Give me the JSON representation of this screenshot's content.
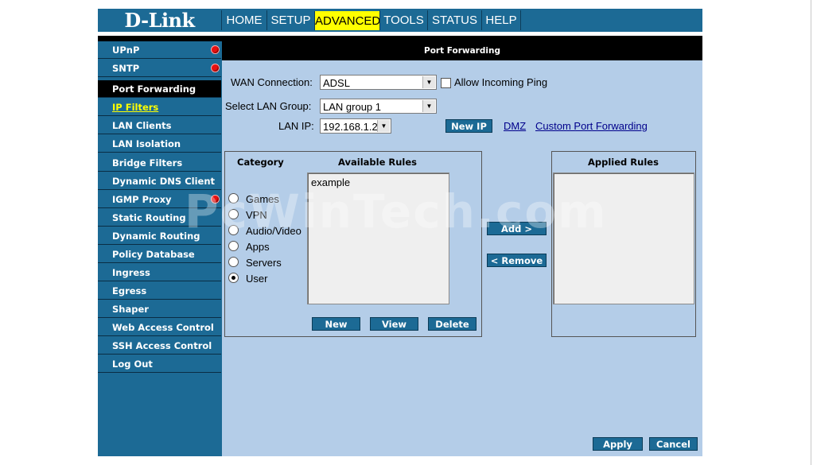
{
  "logo": "D-Link",
  "nav": [
    "HOME",
    "SETUP",
    "ADVANCED",
    "TOOLS",
    "STATUS",
    "HELP"
  ],
  "nav_active": "ADVANCED",
  "sidebar": [
    {
      "label": "UPnP",
      "dot": true
    },
    {
      "label": "SNTP",
      "dot": true
    },
    {
      "label": "Port Forwarding",
      "state": "current"
    },
    {
      "label": "IP Filters",
      "state": "link"
    },
    {
      "label": "LAN Clients"
    },
    {
      "label": "LAN Isolation"
    },
    {
      "label": "Bridge Filters"
    },
    {
      "label": "Dynamic DNS Client"
    },
    {
      "label": "IGMP Proxy",
      "dot": true
    },
    {
      "label": "Static Routing"
    },
    {
      "label": "Dynamic Routing"
    },
    {
      "label": "Policy Database"
    },
    {
      "label": "Ingress"
    },
    {
      "label": "Egress"
    },
    {
      "label": "Shaper"
    },
    {
      "label": "Web Access Control"
    },
    {
      "label": "SSH Access Control"
    },
    {
      "label": "Log Out"
    }
  ],
  "section_title": "Port Forwarding",
  "form": {
    "wan_label": "WAN Connection:",
    "wan_value": "ADSL",
    "ping_label": "Allow Incoming Ping",
    "lan_group_label": "Select LAN Group:",
    "lan_group_value": "LAN group 1",
    "lan_ip_label": "LAN IP:",
    "lan_ip_value": "192.168.1.2",
    "new_ip": "New IP",
    "dmz": "DMZ",
    "custom": "Custom Port Forwarding"
  },
  "rules": {
    "category_header": "Category",
    "available_header": "Available Rules",
    "applied_header": "Applied Rules",
    "categories": [
      "Games",
      "VPN",
      "Audio/Video",
      "Apps",
      "Servers",
      "User"
    ],
    "selected_category": "User",
    "available": [
      "example"
    ],
    "new": "New",
    "view": "View",
    "delete": "Delete",
    "add": "Add >",
    "remove": "< Remove"
  },
  "watermark": "PcWinTech.com",
  "footer": {
    "apply": "Apply",
    "cancel": "Cancel"
  },
  "colors": {
    "brand_blue": "#1c6a95",
    "content_bg": "#b4cde8",
    "active_tab": "#ffff00"
  }
}
